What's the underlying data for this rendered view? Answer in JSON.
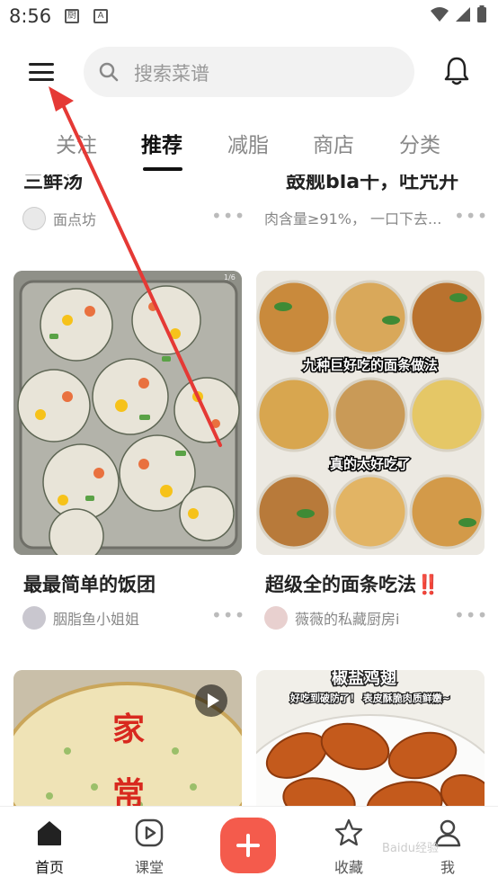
{
  "status_bar": {
    "time": "8:56",
    "icon1": "厨",
    "icon2": "A"
  },
  "header": {
    "menu_icon": "menu-icon",
    "search_placeholder": "搜索菜谱",
    "bell_icon": "bell-icon"
  },
  "tabs": [
    {
      "label": "关注",
      "active": false
    },
    {
      "label": "推荐",
      "active": true
    },
    {
      "label": "减脂",
      "active": false
    },
    {
      "label": "商店",
      "active": false
    },
    {
      "label": "分类",
      "active": false
    }
  ],
  "feed": {
    "prev_cards": [
      {
        "title": "三鲜汤",
        "author": "面点坊",
        "avatar_text": "面点坊"
      },
      {
        "title": "鼓舰bla干，吐咒开心",
        "author": "肉含量≥91%，  一口下去..."
      }
    ],
    "cards": [
      {
        "title": "最最简单的饭团",
        "author": "胭脂鱼小姐姐",
        "badge": "1/6"
      },
      {
        "title": "超级全的面条吃法‼️",
        "author": "薇薇的私藏厨房i",
        "overlay1": "九种巨好吃的面条做法",
        "overlay2": "真的太好吃了"
      },
      {
        "title": "",
        "author": "",
        "overlay_text": "家常"
      },
      {
        "title": "",
        "author": "",
        "overlay_title": "椒盐鸡翅",
        "overlay_sub": "好吃到破防了！ 表皮酥脆肉质鲜嫩~"
      }
    ]
  },
  "bottom_nav": {
    "items": [
      {
        "label": "首页",
        "icon": "home-icon",
        "active": true
      },
      {
        "label": "课堂",
        "icon": "play-icon",
        "active": false
      },
      {
        "label": "收藏",
        "icon": "star-icon",
        "active": false
      },
      {
        "label": "我",
        "icon": "user-icon",
        "active": false
      }
    ],
    "add_icon": "plus-icon"
  },
  "watermark": "Baidu经验",
  "colors": {
    "accent": "#f45b4c",
    "arrow": "#e53935",
    "search_bg": "#f2f2f2"
  }
}
